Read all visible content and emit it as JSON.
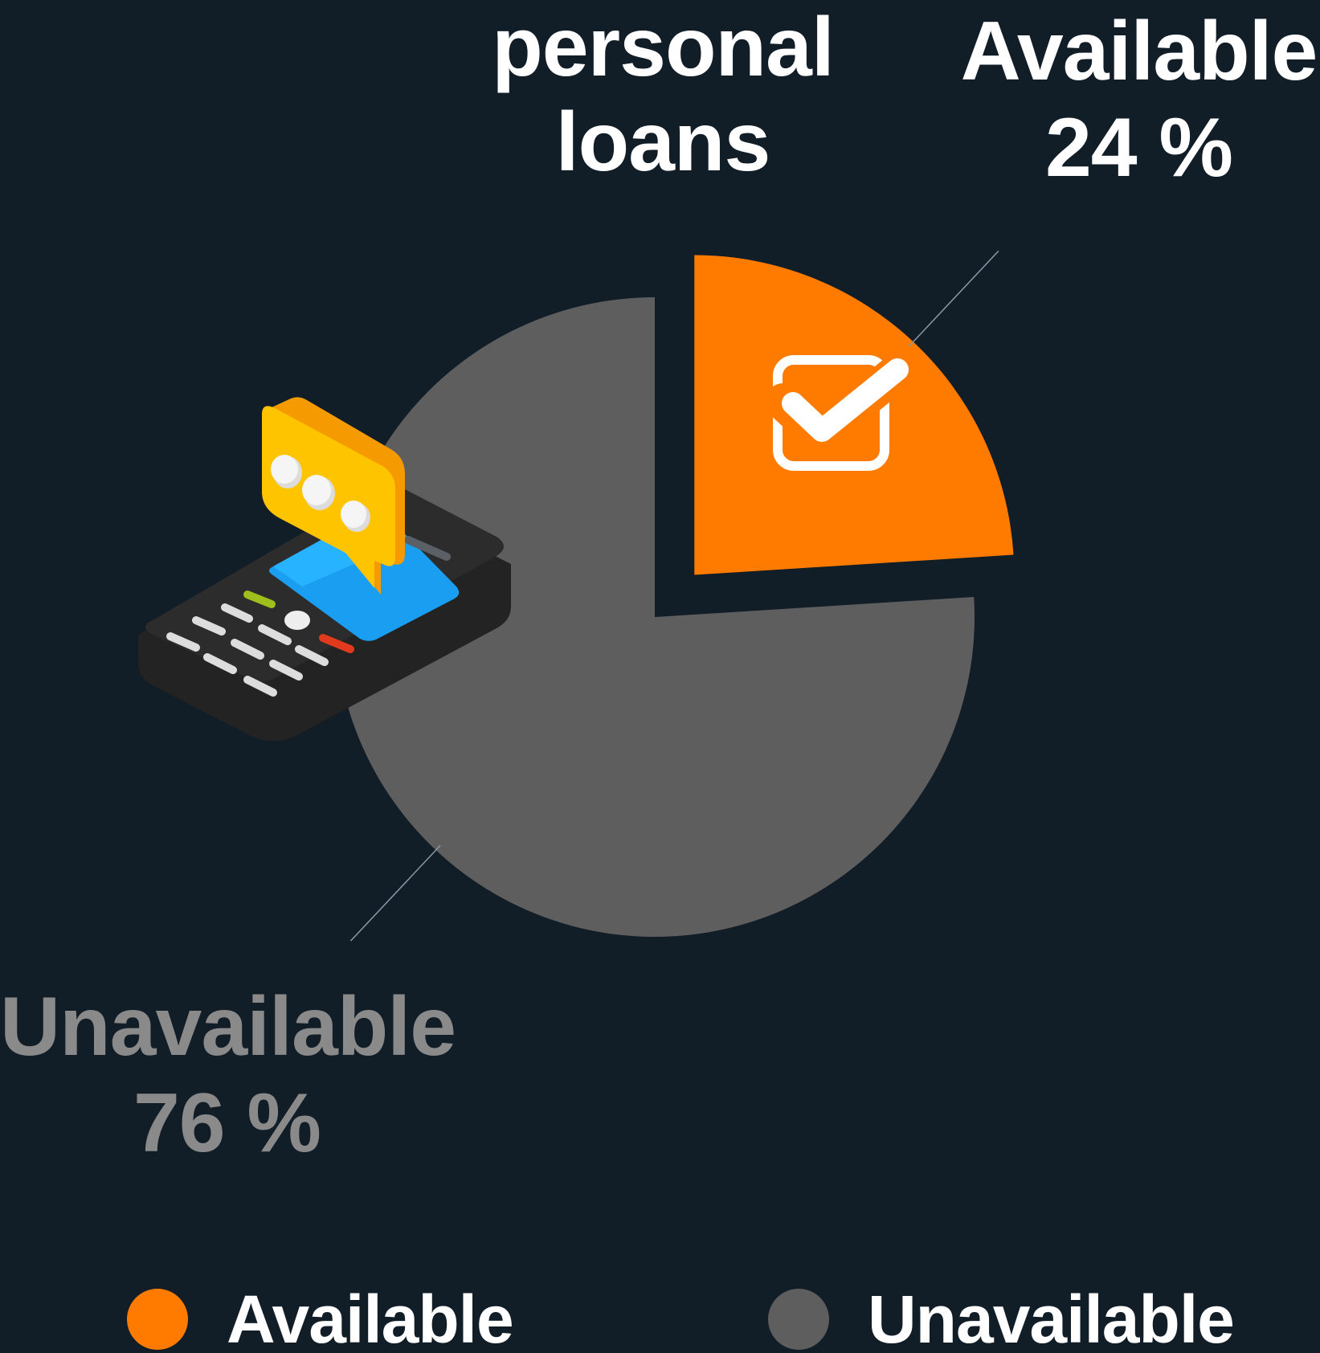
{
  "chart_data": {
    "type": "pie",
    "title": [
      "personal",
      "loans"
    ],
    "slices": [
      {
        "label": "Available",
        "value": 24,
        "display": "24 %",
        "color": "#ff7b00",
        "exploded": true,
        "icon": "checkbox-checked-icon"
      },
      {
        "label": "Unavailable",
        "value": 76,
        "display": "76 %",
        "color": "#5e5e5e",
        "exploded": false
      }
    ],
    "legend": {
      "placement": "bottom",
      "items": [
        {
          "label": "Available",
          "color": "#ff7b00"
        },
        {
          "label": "Unavailable",
          "color": "#5e5e5e"
        }
      ]
    },
    "decoration": "mobile-phone-chat-icon"
  }
}
